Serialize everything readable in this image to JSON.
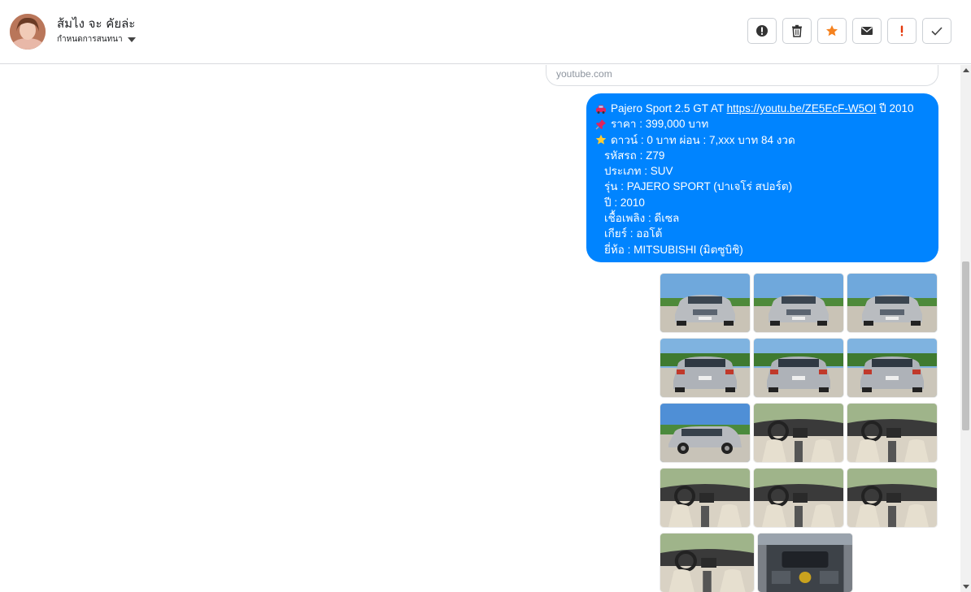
{
  "header": {
    "contact_name": "ส้มไง จะ คัยล่ะ",
    "settings_label": "กำหนดการสนทนา",
    "actions": [
      "info-icon",
      "trash-icon",
      "star-icon",
      "mail-icon",
      "exclamation-icon",
      "check-icon"
    ]
  },
  "link_preview": {
    "domain": "youtube.com"
  },
  "message": {
    "line1_text": "Pajero Sport 2.5 GT AT ",
    "line1_link": "https://youtu.be/ZE5EcF-W5OI",
    "line1_suffix": " ปี 2010",
    "price": "ราคา : 399,000 บาท",
    "down": "ดาวน์ : 0 บาท ผ่อน : 7,xxx บาท 84 งวด",
    "code": "รหัสรถ : Z79",
    "type": "ประเภท : SUV",
    "model": "รุ่น : PAJERO SPORT (ปาเจโร่ สปอร์ต)",
    "year": "ปี : 2010",
    "fuel": "เชื้อเพลิง : ดีเซล",
    "gear": "เกียร์ : ออโต้",
    "brand": "ยี่ห้อ : MITSUBISHI (มิตซูบิชิ)"
  },
  "photos": [
    "front",
    "front",
    "front",
    "rear",
    "rear",
    "rear",
    "side",
    "interior",
    "interior",
    "interior",
    "interior",
    "interior",
    "interior",
    "engine"
  ],
  "colors": {
    "messenger_blue": "#0084ff",
    "star_orange": "#f5821f",
    "alert_red": "#e4380a"
  }
}
